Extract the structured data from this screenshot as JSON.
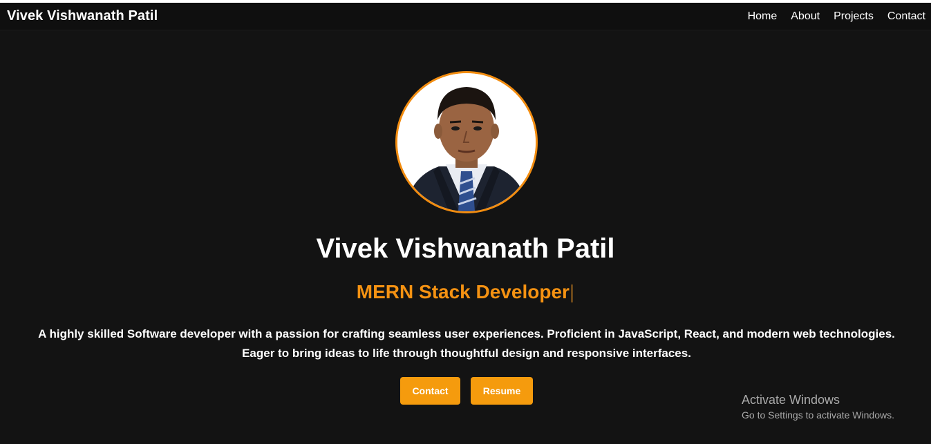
{
  "navbar": {
    "brand": "Vivek Vishwanath Patil",
    "links": [
      "Home",
      "About",
      "Projects",
      "Contact"
    ]
  },
  "hero": {
    "avatar_icon": "profile-photo",
    "name": "Vivek Vishwanath Patil",
    "role": "MERN Stack Developer",
    "typing_cursor": "|",
    "bio": "A highly skilled Software developer with a passion for crafting seamless user experiences. Proficient in JavaScript, React, and modern web technologies. Eager to bring ideas to life through thoughtful design and responsive interfaces.",
    "buttons": {
      "contact": "Contact",
      "resume": "Resume"
    }
  },
  "watermark": {
    "title": "Activate Windows",
    "subtitle": "Go to Settings to activate Windows."
  },
  "colors": {
    "background": "#131313",
    "accent": "#f59b0d",
    "text": "#ffffff"
  }
}
